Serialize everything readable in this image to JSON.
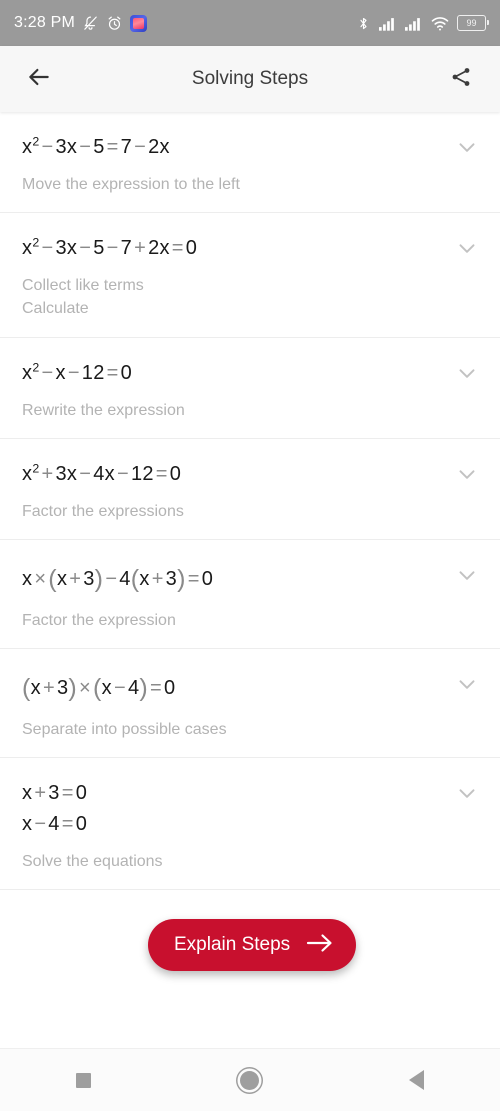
{
  "status_bar": {
    "time": "3:28 PM",
    "battery_level": "99",
    "icons": [
      "notifications-off-icon",
      "alarm-icon",
      "app-icon",
      "bluetooth-icon",
      "signal-icon",
      "signal-icon",
      "wifi-icon",
      "battery-icon"
    ]
  },
  "app_bar": {
    "title": "Solving Steps",
    "back_icon": "back-arrow-icon",
    "share_icon": "share-icon"
  },
  "steps": [
    {
      "expression_lines": [
        "x<sup>2</sup><span class=\"op\">&minus;</span>3x<span class=\"op\">&minus;</span>5<span class=\"op\">=</span>7<span class=\"op\">&minus;</span>2x"
      ],
      "expression_text": "x^2 - 3x - 5 = 7 - 2x",
      "description_lines": [
        "Move the expression to the left"
      ]
    },
    {
      "expression_lines": [
        "x<sup>2</sup><span class=\"op\">&minus;</span>3x<span class=\"op\">&minus;</span>5<span class=\"op\">&minus;</span>7<span class=\"op\">+</span>2x<span class=\"op\">=</span>0"
      ],
      "expression_text": "x^2 - 3x - 5 - 7 + 2x = 0",
      "description_lines": [
        "Collect like terms",
        "Calculate"
      ]
    },
    {
      "expression_lines": [
        "x<sup>2</sup><span class=\"op\">&minus;</span>x<span class=\"op\">&minus;</span>12<span class=\"op\">=</span>0"
      ],
      "expression_text": "x^2 - x - 12 = 0",
      "description_lines": [
        "Rewrite the expression"
      ]
    },
    {
      "expression_lines": [
        "x<sup>2</sup><span class=\"op\">+</span>3x<span class=\"op\">&minus;</span>4x<span class=\"op\">&minus;</span>12<span class=\"op\">=</span>0"
      ],
      "expression_text": "x^2 + 3x - 4x - 12 = 0",
      "description_lines": [
        "Factor the expressions"
      ]
    },
    {
      "expression_lines": [
        "x<span class=\"op\">&times;</span><span class=\"paren\">(</span>x<span class=\"op\">+</span>3<span class=\"paren\">)</span><span class=\"op\">&minus;</span>4<span class=\"paren\">(</span>x<span class=\"op\">+</span>3<span class=\"paren\">)</span><span class=\"op\">=</span>0"
      ],
      "expression_text": "x × (x + 3) - 4(x + 3) = 0",
      "description_lines": [
        "Factor the expression"
      ]
    },
    {
      "expression_lines": [
        "<span class=\"paren\">(</span>x<span class=\"op\">+</span>3<span class=\"paren\">)</span><span class=\"op\">&times;</span><span class=\"paren\">(</span>x<span class=\"op\">&minus;</span>4<span class=\"paren\">)</span><span class=\"op\">=</span>0"
      ],
      "expression_text": "(x + 3) × (x - 4) = 0",
      "description_lines": [
        "Separate into possible cases"
      ]
    },
    {
      "expression_lines": [
        "x<span class=\"op\">+</span>3<span class=\"op\">=</span>0",
        "x<span class=\"op\">&minus;</span>4<span class=\"op\">=</span>0"
      ],
      "expression_text": "x + 3 = 0 ; x - 4 = 0",
      "description_lines": [
        "Solve the equations"
      ]
    }
  ],
  "step_expand_icon": "chevron-down-icon",
  "fab": {
    "label": "Explain Steps",
    "icon": "arrow-right-icon",
    "color": "#c8102e"
  },
  "nav_bar": {
    "recents_icon": "square-recents-icon",
    "home_icon": "circle-home-icon",
    "back_icon": "triangle-back-icon"
  }
}
